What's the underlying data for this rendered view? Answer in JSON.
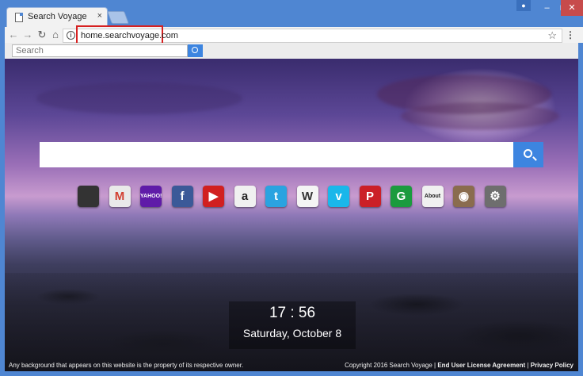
{
  "browser": {
    "tab_title": "Search Voyage",
    "tab_close": "×",
    "url": "home.searchvoyage.com",
    "back_glyph": "←",
    "forward_glyph": "→",
    "reload_glyph": "↻",
    "home_glyph": "⌂",
    "star_glyph": "☆",
    "menu_glyph": "⋮",
    "info_glyph": "i",
    "win_minimize": "–",
    "win_maximize": "□",
    "win_close": "✕"
  },
  "extension_bar": {
    "search_placeholder": "Search"
  },
  "shortcuts": [
    {
      "name": "switch",
      "label": "",
      "color": "#333333",
      "icon": "swap-icon"
    },
    {
      "name": "gmail",
      "label": "M",
      "color": "#e9e9e9",
      "text_color": "#d23f31",
      "icon": "gmail-icon"
    },
    {
      "name": "yahoo",
      "label": "YAHOO!",
      "color": "#5f1ba8",
      "icon": "yahoo-icon"
    },
    {
      "name": "facebook",
      "label": "f",
      "color": "#3b5998",
      "icon": "facebook-icon"
    },
    {
      "name": "youtube",
      "label": "▶",
      "color": "#d12020",
      "icon": "youtube-icon"
    },
    {
      "name": "amazon",
      "label": "a",
      "color": "#f0f0f0",
      "text_color": "#222222",
      "icon": "amazon-icon"
    },
    {
      "name": "twitter",
      "label": "t",
      "color": "#2aa3e0",
      "icon": "twitter-icon"
    },
    {
      "name": "wikipedia",
      "label": "W",
      "color": "#f4f4f4",
      "text_color": "#333333",
      "icon": "wikipedia-icon"
    },
    {
      "name": "vimeo",
      "label": "v",
      "color": "#1ab7ea",
      "icon": "vimeo-icon"
    },
    {
      "name": "pinterest",
      "label": "P",
      "color": "#cb2027",
      "icon": "pinterest-icon"
    },
    {
      "name": "grammarly",
      "label": "G",
      "color": "#1b9b3e",
      "icon": "grammarly-icon"
    },
    {
      "name": "about",
      "label": "About",
      "color": "#f0f0f0",
      "text_color": "#222222",
      "icon": "about-icon"
    },
    {
      "name": "instagram",
      "label": "◉",
      "color": "#8a6c4e",
      "icon": "instagram-icon"
    },
    {
      "name": "settings",
      "label": "⚙",
      "color": "#6e6e6e",
      "icon": "settings-icon"
    }
  ],
  "clock": {
    "time": "17 : 56",
    "date": "Saturday, October 8"
  },
  "footer": {
    "disclaimer": "Any background that appears on this website is the property of its respective owner.",
    "copyright": "Copyright 2016 Search Voyage | ",
    "eula": "End User License Agreement",
    "sep": " | ",
    "privacy": "Privacy Policy"
  },
  "colors": {
    "frame": "#4f86d2",
    "accent_button": "#3d85e0",
    "highlight_box": "#d62020"
  }
}
